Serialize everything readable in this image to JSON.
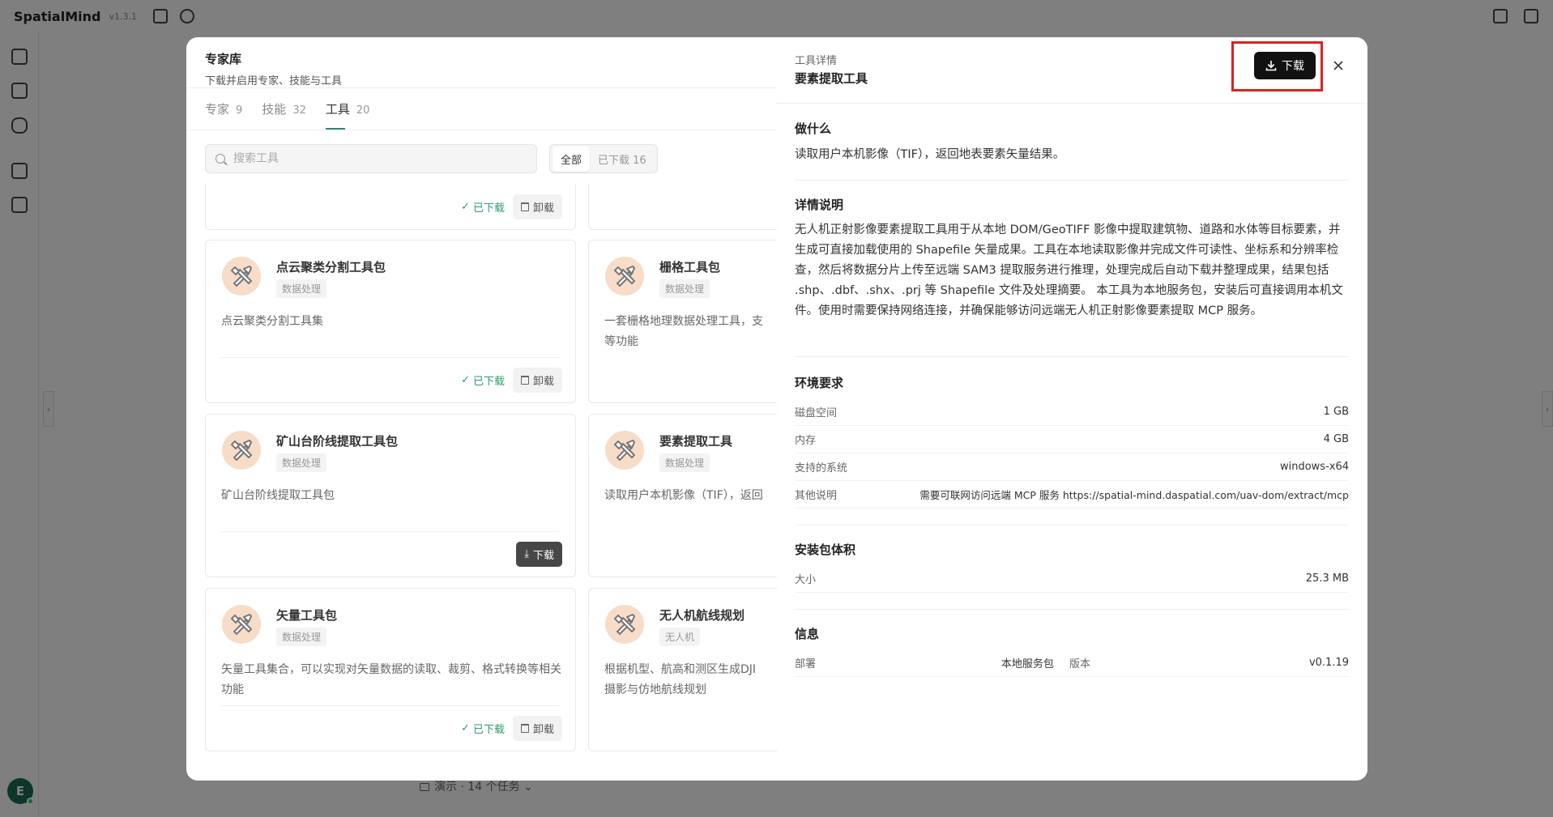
{
  "app": {
    "name": "SpatialMind",
    "version": "v1.3.1"
  },
  "user": {
    "initial": "E"
  },
  "background": {
    "task_label": "演示 · 14 个任务"
  },
  "library": {
    "title": "专家库",
    "subtitle": "下载并启用专家、技能与工具",
    "tabs": [
      {
        "label": "专家",
        "count": "9"
      },
      {
        "label": "技能",
        "count": "32"
      },
      {
        "label": "工具",
        "count": "20"
      }
    ],
    "search_placeholder": "搜索工具",
    "filters": [
      {
        "label": "全部"
      },
      {
        "label": "已下载 16"
      }
    ],
    "downloaded_label": "已下载",
    "uninstall_label": "卸载",
    "download_label": "下载",
    "cards": [
      {
        "name": "点云聚类分割工具包",
        "tag": "数据处理",
        "desc": "点云聚类分割工具集"
      },
      {
        "name": "栅格工具包",
        "tag": "数据处理",
        "desc": "一套栅格地理数据处理工具，支\n等功能"
      },
      {
        "name": "矿山台阶线提取工具包",
        "tag": "数据处理",
        "desc": "矿山台阶线提取工具包"
      },
      {
        "name": "要素提取工具",
        "tag": "数据处理",
        "desc": "读取用户本机影像（TIF），返回"
      },
      {
        "name": "矢量工具包",
        "tag": "数据处理",
        "desc": "矢量工具集合，可以实现对矢量数据的读取、裁剪、格式转换等相关功能"
      },
      {
        "name": "无人机航线规划",
        "tag": "无人机",
        "desc": "根据机型、航高和测区生成DJI\n摄影与仿地航线规划"
      }
    ]
  },
  "detail": {
    "label": "工具详情",
    "title": "要素提取工具",
    "download_label": "下载",
    "what_title": "做什么",
    "what_text": "读取用户本机影像（TIF），返回地表要素矢量结果。",
    "desc_title": "详情说明",
    "desc_text": "无人机正射影像要素提取工具用于从本地 DOM/GeoTIFF 影像中提取建筑物、道路和水体等目标要素，并生成可直接加载使用的 Shapefile 矢量成果。工具在本地读取影像并完成文件可读性、坐标系和分辨率检查，然后将数据分片上传至远端 SAM3 提取服务进行推理，处理完成后自动下载并整理成果，结果包括 .shp、.dbf、.shx、.prj 等 Shapefile 文件及处理摘要。 本工具为本地服务包，安装后可直接调用本机文件。使用时需要保持网络连接，并确保能够访问远端无人机正射影像要素提取 MCP 服务。",
    "env_title": "环境要求",
    "env": [
      {
        "key": "磁盘空间",
        "value": "1 GB"
      },
      {
        "key": "内存",
        "value": "4 GB"
      },
      {
        "key": "支持的系统",
        "value": "windows-x64"
      },
      {
        "key": "其他说明",
        "value": "需要可联网访问远端 MCP 服务 https://spatial-mind.daspatial.com/uav-dom/extract/mcp"
      }
    ],
    "size_title": "安装包体积",
    "size": {
      "key": "大小",
      "value": "25.3 MB"
    },
    "info_title": "信息",
    "info": {
      "deploy_key": "部署",
      "deploy_value": "本地服务包",
      "version_key": "版本",
      "version_value": "v0.1.19"
    }
  }
}
